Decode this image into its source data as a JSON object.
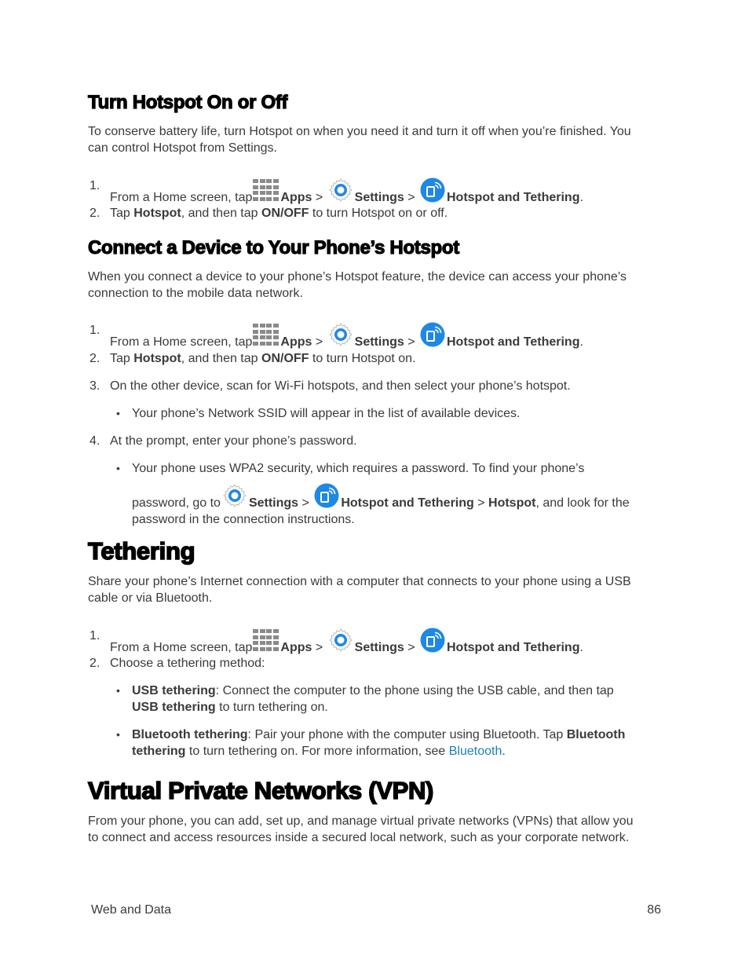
{
  "sections": {
    "turn_hotspot": {
      "heading": "Turn Hotspot On or Off",
      "intro_line1": "To conserve battery life, turn Hotspot on when you need it and turn it off when you’re finished. You",
      "intro_line2": "can control Hotspot from Settings.",
      "steps": [
        {
          "num": "1.",
          "pre": "From a Home screen, tap",
          "apps": "Apps",
          "sep1": " > ",
          "settings": "Settings",
          "sep2": " > ",
          "hotspot": "Hotspot and Tethering",
          "end": "."
        },
        {
          "num": "2.",
          "t1": "Tap ",
          "b1": "Hotspot",
          "t2": ", and then tap ",
          "b2": "ON/OFF",
          "t3": " to turn Hotspot on or off."
        }
      ]
    },
    "connect_device": {
      "heading": "Connect a Device to Your Phone’s Hotspot",
      "intro_line1": "When you connect a device to your phone’s Hotspot feature, the device can access your phone’s",
      "intro_line2": "connection to the mobile data network.",
      "steps": [
        {
          "num": "1.",
          "pre": "From a Home screen, tap",
          "apps": "Apps",
          "sep1": " > ",
          "settings": "Settings",
          "sep2": " > ",
          "hotspot": "Hotspot and Tethering",
          "end": "."
        },
        {
          "num": "2.",
          "t1": "Tap ",
          "b1": "Hotspot",
          "t2": ", and then tap ",
          "b2": "ON/OFF",
          "t3": " to turn Hotspot on."
        },
        {
          "num": "3.",
          "text": "On the other device, scan for Wi-Fi hotspots, and then select your phone’s hotspot."
        },
        {
          "num": "4.",
          "text": "At the prompt, enter your phone’s password."
        }
      ],
      "bullets": [
        {
          "text": "Your phone’s Network SSID will appear in the list of available devices."
        },
        {
          "line1": "Your phone uses WPA2 security, which requires a password. To find your phone’s",
          "pre": "password, go to",
          "settings": "Settings",
          "sep1": " > ",
          "hotspot": "Hotspot and Tethering",
          "sep2": " > ",
          "hotspot_tab": "Hotspot",
          "post": ", and look for the",
          "line3": "password in the connection instructions."
        }
      ]
    },
    "tethering": {
      "heading": "Tethering",
      "intro_line1": "Share your phone’s Internet connection with a computer that connects to your phone using a USB",
      "intro_line2": "cable or via Bluetooth.",
      "steps": [
        {
          "num": "1.",
          "pre": "From a Home screen, tap",
          "apps": "Apps",
          "sep1": " > ",
          "settings": "Settings",
          "sep2": " > ",
          "hotspot": "Hotspot and Tethering",
          "end": "."
        },
        {
          "num": "2.",
          "text": "Choose a tethering method:"
        }
      ],
      "bullets": [
        {
          "b1": "USB tethering",
          "t1": ": Connect the computer to the phone using the USB cable, and then tap",
          "b2": "USB tethering",
          "t2": " to turn tethering on."
        },
        {
          "b1": "Bluetooth tethering",
          "t1": ": Pair your phone with the computer using Bluetooth. Tap ",
          "b2": "Bluetooth",
          "b3": "tethering",
          "t2": " to turn tethering on. For more information, see ",
          "link": "Bluetooth",
          "end": "."
        }
      ]
    },
    "vpn": {
      "heading": "Virtual Private Networks (VPN)",
      "intro_line1": "From your phone, you can add, set up, and manage virtual private networks (VPNs) that allow you",
      "intro_line2": "to connect and access resources inside a secured local network, such as your corporate network."
    }
  },
  "icons": {
    "apps": "apps-grid-icon",
    "settings": "settings-gear-icon",
    "hotspot": "hotspot-icon"
  },
  "colors": {
    "link": "#1a7fc1",
    "icon_blue": "#1e88e5",
    "text": "#3a3a3a"
  },
  "footer": {
    "section": "Web and Data",
    "page": "86"
  }
}
